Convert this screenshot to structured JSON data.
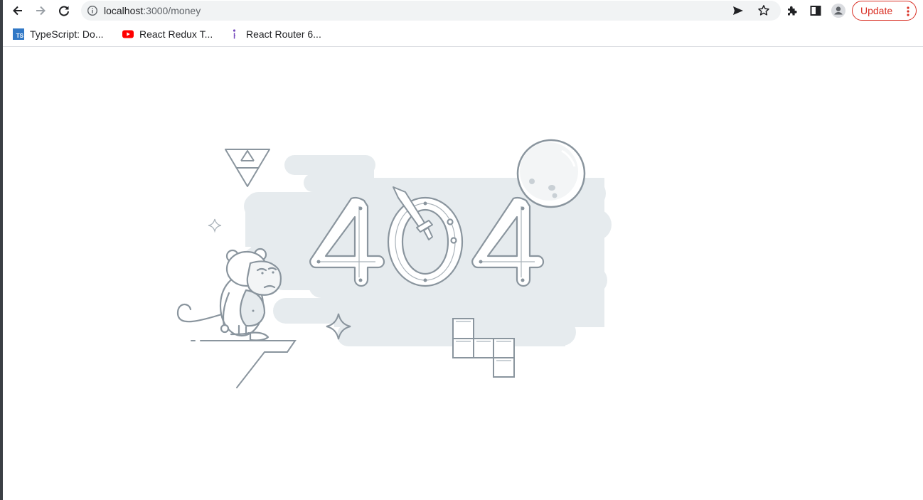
{
  "browser": {
    "nav": {
      "back_icon": "arrow-left-icon",
      "forward_icon": "arrow-right-icon",
      "reload_icon": "reload-icon"
    },
    "address_bar": {
      "host": "localhost",
      "path": ":3000/money",
      "info_icon": "info-icon"
    },
    "actions": {
      "send_icon": "send-tab-icon",
      "bookmark_icon": "star-icon",
      "extensions_icon": "puzzle-icon",
      "side_panel_icon": "side-panel-icon",
      "profile_icon": "profile-avatar-icon",
      "update_label": "Update",
      "menu_icon": "kebab-menu-icon"
    },
    "bookmarks": [
      {
        "label": "TypeScript: Do...",
        "icon": "typescript-icon",
        "icon_text": "TS"
      },
      {
        "label": "React Redux T...",
        "icon": "youtube-icon"
      },
      {
        "label": "React Router 6...",
        "icon": "bookmark-favicon"
      }
    ]
  },
  "page": {
    "illustration": "404-octocat-illustration",
    "digits": [
      "4",
      "0",
      "4"
    ]
  },
  "colors": {
    "accent_red": "#d93025",
    "illustration_stroke": "#8a959e",
    "cloud_fill": "#e6ebee",
    "typescript_blue": "#3178c6",
    "youtube_red": "#ff0000"
  }
}
